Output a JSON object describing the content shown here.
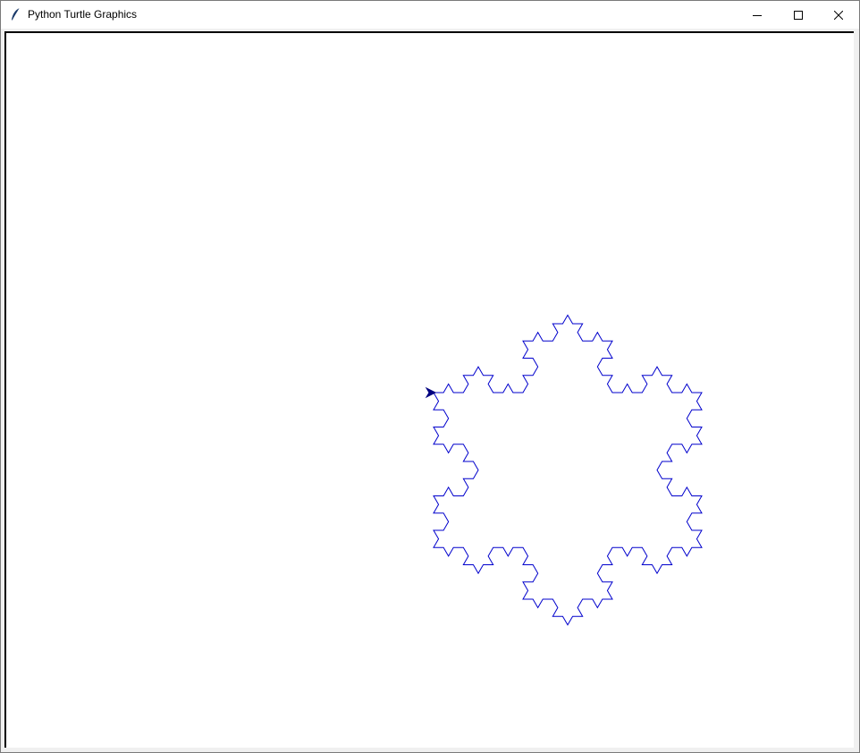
{
  "window": {
    "title": "Python Turtle Graphics",
    "icon": "feather-icon",
    "controls": {
      "minimize_icon": "minimize-icon",
      "maximize_icon": "maximize-icon",
      "close_icon": "close-icon"
    }
  },
  "canvas": {
    "background": "#ffffff",
    "drawing": "koch-snowflake",
    "pen_color": "#0000cc",
    "turtle_color": "#000080"
  }
}
